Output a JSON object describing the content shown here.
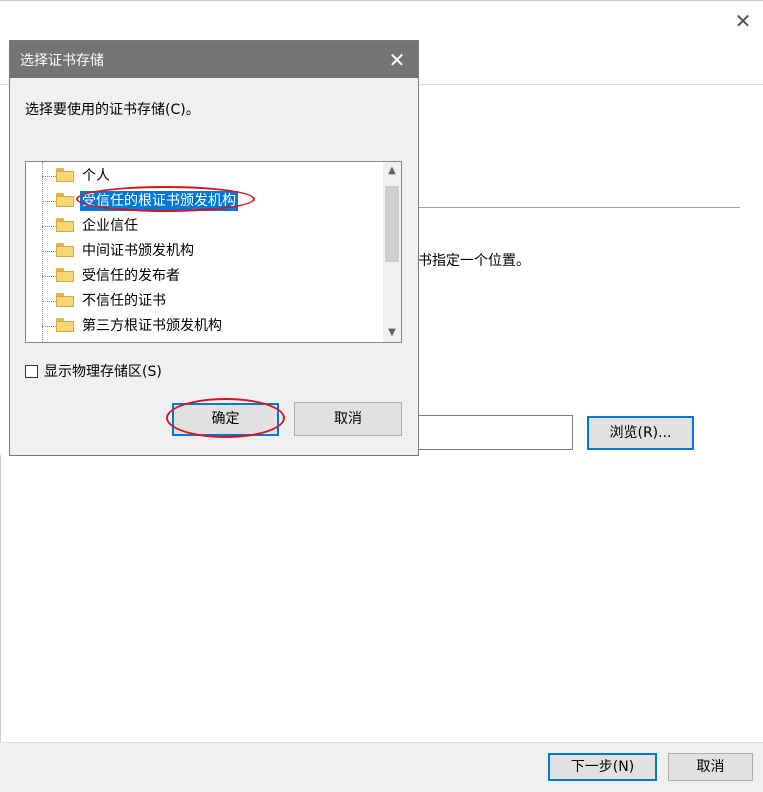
{
  "wizard": {
    "description_fragment": "书指定一个位置。",
    "browse_label": "浏览(R)...",
    "next_label": "下一步(N)",
    "cancel_label": "取消",
    "close_glyph": "✕"
  },
  "dialog": {
    "title": "选择证书存储",
    "close_glyph": "✕",
    "prompt": "选择要使用的证书存储(C)。",
    "stores": [
      {
        "label": "个人",
        "selected": false
      },
      {
        "label": "受信任的根证书颁发机构",
        "selected": true
      },
      {
        "label": "企业信任",
        "selected": false
      },
      {
        "label": "中间证书颁发机构",
        "selected": false
      },
      {
        "label": "受信任的发布者",
        "selected": false
      },
      {
        "label": "不信任的证书",
        "selected": false
      },
      {
        "label": "第三方根证书颁发机构",
        "selected": false
      }
    ],
    "show_physical_label": "显示物理存储区(S)",
    "show_physical_checked": false,
    "ok_label": "确定",
    "cancel_label": "取消"
  },
  "colors": {
    "accent": "#0078d7",
    "titlebar": "#747474",
    "annotation": "#d9141e",
    "folder": "#f8d775"
  }
}
